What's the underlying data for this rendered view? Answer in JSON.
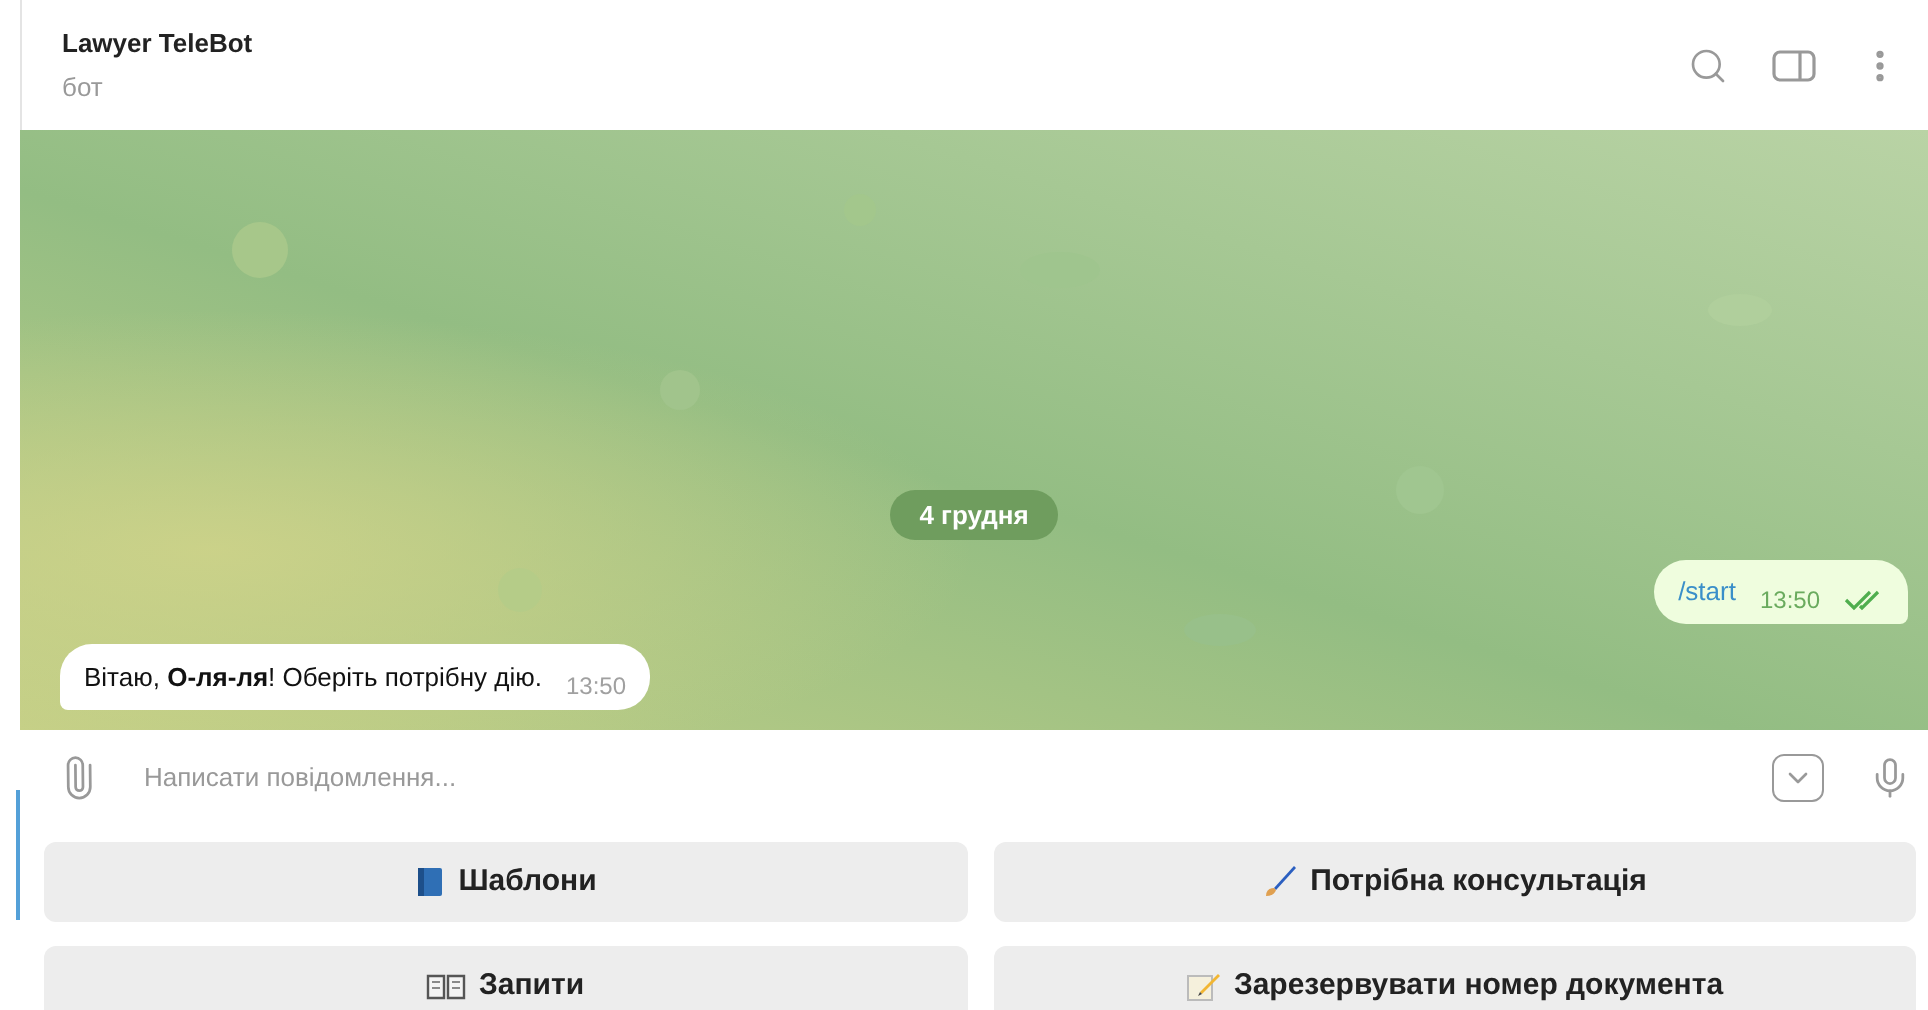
{
  "header": {
    "title": "Lawyer TeleBot",
    "subtitle": "бот"
  },
  "chat": {
    "date_badge": "4 грудня",
    "messages": [
      {
        "kind": "outgoing",
        "text": "/start",
        "time": "13:50",
        "read": true
      },
      {
        "kind": "incoming",
        "text": "Вітаю, **О-ля-ля**! Оберіть потрібну дію.",
        "time": "13:50"
      }
    ]
  },
  "composer": {
    "placeholder": "Написати повідомлення..."
  },
  "keyboard": [
    {
      "label": "Шаблони"
    },
    {
      "label": "Потрібна консультація"
    },
    {
      "label": "Запити"
    },
    {
      "label": "Зарезервувати номер документа"
    }
  ]
}
